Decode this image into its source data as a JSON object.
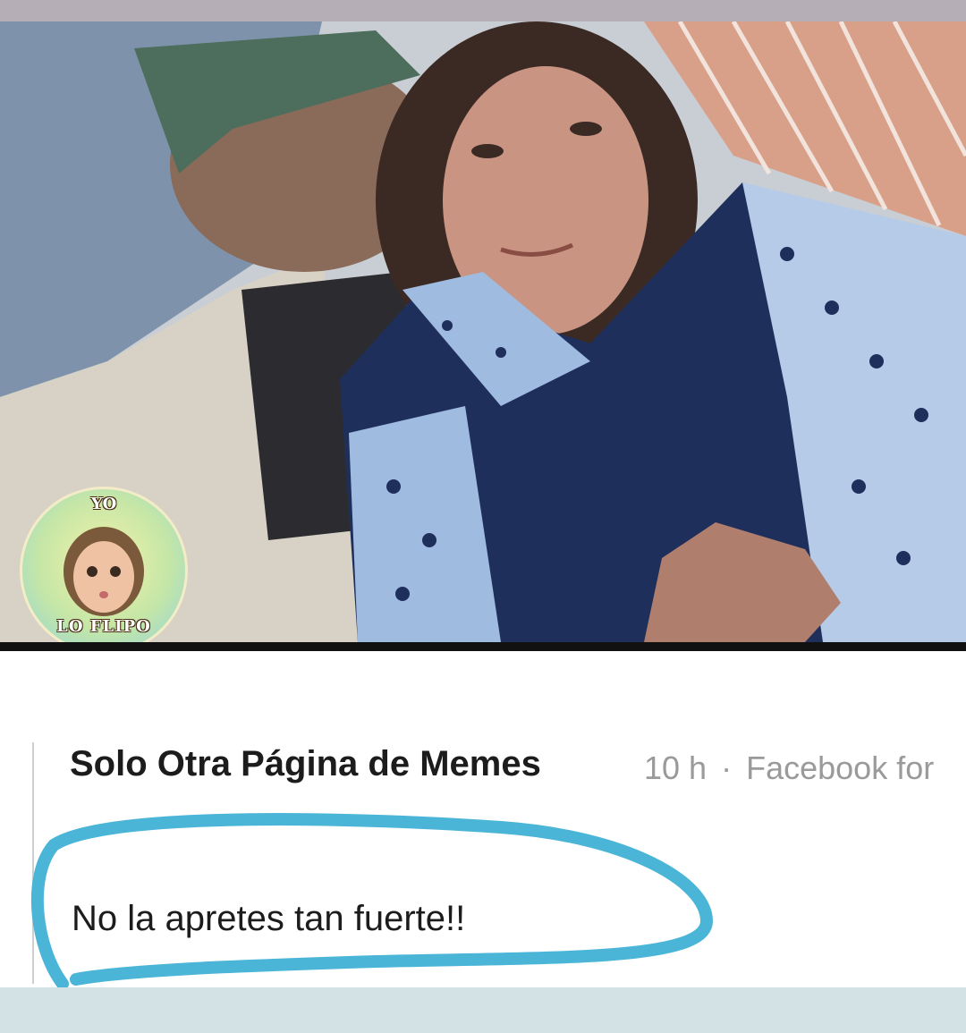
{
  "watermark": {
    "top_text": "YO",
    "bottom_text": "LO FLIPO"
  },
  "post": {
    "page_name": "Solo Otra Página de Memes",
    "time": "10 h",
    "separator": "·",
    "source": "Facebook for",
    "caption": "No la apretes tan fuerte!!"
  },
  "colors": {
    "highlight_circle": "#4bb5d8",
    "top_strip": "#b6aeb6",
    "bottom_bar": "#d3e2e4"
  }
}
